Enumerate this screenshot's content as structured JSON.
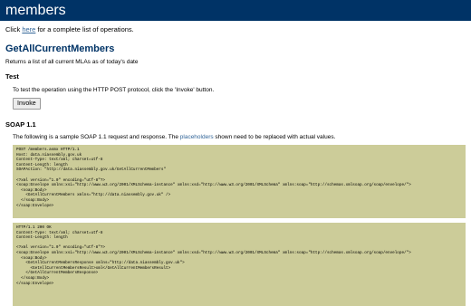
{
  "page": {
    "service_name": "members"
  },
  "intro": {
    "prefix": "Click ",
    "link": "here",
    "suffix": " for a complete list of operations."
  },
  "operation": {
    "name": "GetAllCurrentMembers",
    "description": "Returns a list of all current MLAs as of today's date"
  },
  "test": {
    "heading": "Test",
    "text": "To test the operation using the HTTP POST protocol, click the 'Invoke' button.",
    "button": "Invoke"
  },
  "soap": {
    "heading": "SOAP 1.1",
    "desc_prefix": "The following is a sample SOAP 1.1 request and response.  The ",
    "desc_link": "placeholders",
    "desc_suffix": " shown need to be replaced with actual values.",
    "request": [
      "POST /members.asmx HTTP/1.1",
      "Host: data.niassembly.gov.uk",
      "Content-Type: text/xml; charset=utf-8",
      "Content-Length: length",
      "SOAPAction: \"http://data.niassembly.gov.uk/GetAllCurrentMembers\"",
      "",
      "<?xml version=\"1.0\" encoding=\"utf-8\"?>",
      "<soap:Envelope xmlns:xsi=\"http://www.w3.org/2001/XMLSchema-instance\" xmlns:xsd=\"http://www.w3.org/2001/XMLSchema\" xmlns:soap=\"http://schemas.xmlsoap.org/soap/envelope/\">",
      "  <soap:Body>",
      "    <GetAllCurrentMembers xmlns=\"http://data.niassembly.gov.uk\" />",
      "  </soap:Body>",
      "</soap:Envelope>"
    ],
    "response": [
      "HTTP/1.1 200 OK",
      "Content-Type: text/xml; charset=utf-8",
      "Content-Length: length",
      "",
      "<?xml version=\"1.0\" encoding=\"utf-8\"?>",
      "<soap:Envelope xmlns:xsi=\"http://www.w3.org/2001/XMLSchema-instance\" xmlns:xsd=\"http://www.w3.org/2001/XMLSchema\" xmlns:soap=\"http://schemas.xmlsoap.org/soap/envelope/\">",
      "  <soap:Body>",
      "    <GetAllCurrentMembersResponse xmlns=\"http://data.niassembly.gov.uk\">",
      "      <GetAllCurrentMembersResult>xml</GetAllCurrentMembersResult>",
      "    </GetAllCurrentMembersResponse>",
      "  </soap:Body>",
      "</soap:Envelope>"
    ]
  }
}
